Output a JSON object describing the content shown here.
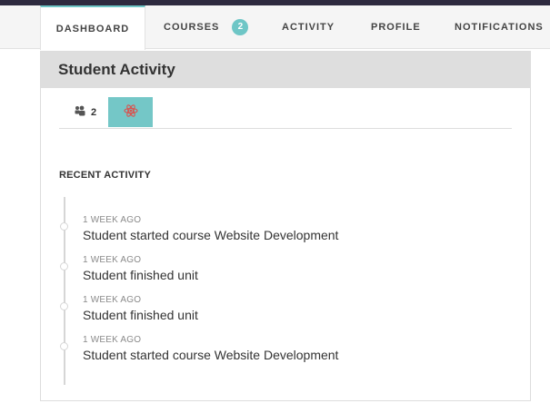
{
  "nav": {
    "tabs": [
      {
        "label": "DASHBOARD"
      },
      {
        "label": "COURSES",
        "badge": "2"
      },
      {
        "label": "ACTIVITY"
      },
      {
        "label": "PROFILE"
      },
      {
        "label": "NOTIFICATIONS"
      }
    ],
    "active": "DASHBOARD"
  },
  "card": {
    "title": "Student Activity",
    "subtabs": {
      "users": {
        "icon": "users-icon",
        "count": "2"
      },
      "atom": {
        "icon": "atom-icon"
      },
      "active": "atom"
    }
  },
  "recent_activity": {
    "heading": "RECENT ACTIVITY",
    "items": [
      {
        "time": "1 WEEK AGO",
        "text": "Student started course Website Development"
      },
      {
        "time": "1 WEEK AGO",
        "text": "Student finished unit"
      },
      {
        "time": "1 WEEK AGO",
        "text": "Student finished unit"
      },
      {
        "time": "1 WEEK AGO",
        "text": "Student started course Website Development"
      }
    ]
  },
  "colors": {
    "accent": "#74c7c7",
    "topbar": "#2d2a3f",
    "icon_red": "#d9534f"
  }
}
